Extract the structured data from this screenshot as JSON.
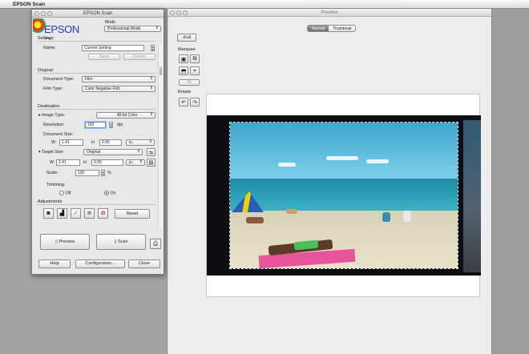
{
  "menubar": {
    "app_name": "EPSON Scan"
  },
  "preview": {
    "title": "Preview",
    "tabs": [
      {
        "label": "Normal",
        "selected": true
      },
      {
        "label": "Thumbnail",
        "selected": false
      }
    ],
    "full_button": "Full",
    "marquee_label": "Marquee",
    "all_button": "All",
    "rotate_label": "Rotate"
  },
  "epson": {
    "title": "EPSON Scan",
    "logo_text": "EPSON Scan",
    "mode_label": "Mode:",
    "mode_value": "Professional Mode",
    "settings": {
      "section": "Settings",
      "name_label": "Name:",
      "name_value": "Current Setting",
      "save": "Save",
      "delete": "Delete"
    },
    "original": {
      "section": "Original",
      "doc_type_label": "Document Type:",
      "doc_type_value": "Film",
      "film_type_label": "Film Type:",
      "film_type_value": "Color Negative Film"
    },
    "destination": {
      "section": "Destination",
      "image_type_label": "Image Type:",
      "image_type_value": "48-bit Color",
      "resolution_label": "Resolution:",
      "resolution_value": "150",
      "resolution_unit": "dpi",
      "doc_size_label": "Document Size:",
      "w_label": "W",
      "w_value": "1.41",
      "h_label": "H",
      "h_value": "0.96",
      "unit_value": "in.",
      "target_size_label": "Target Size:",
      "target_size_value": "Original",
      "tw_value": "1.41",
      "th_value": "0.95",
      "scale_label": "Scale:",
      "scale_value": "100",
      "scale_unit": "%",
      "trimming_label": "Trimming:",
      "off_label": "Off",
      "on_label": "On"
    },
    "adjustments": {
      "section": "Adjustments",
      "reset": "Reset"
    },
    "buttons": {
      "preview": "Preview",
      "scan": "Scan",
      "help": "Help",
      "configuration": "Configuration...",
      "close": "Close"
    }
  }
}
